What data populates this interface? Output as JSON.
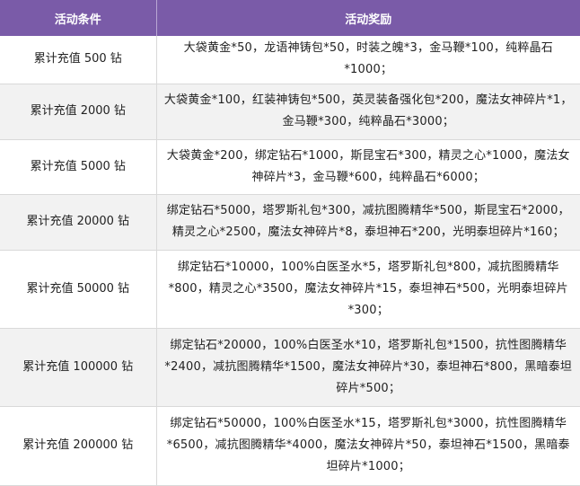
{
  "table": {
    "headers": [
      "活动条件",
      "活动奖励"
    ],
    "rows": [
      {
        "condition": "累计充值 500 钻",
        "reward": "大袋黄金*50，龙语神铸包*50，时装之魄*3，金马鞭*100，纯粹晶石*1000；"
      },
      {
        "condition": "累计充值 2000 钻",
        "reward": "大袋黄金*100，红装神铸包*500，英灵装备强化包*200，魔法女神碎片*1，金马鞭*300，纯粹晶石*3000；"
      },
      {
        "condition": "累计充值 5000 钻",
        "reward": "大袋黄金*200，绑定钻石*1000，斯昆宝石*300，精灵之心*1000，魔法女神碎片*3，金马鞭*600，纯粹晶石*6000；"
      },
      {
        "condition": "累计充值 20000 钻",
        "reward": "绑定钻石*5000，塔罗斯礼包*300，减抗图腾精华*500，斯昆宝石*2000，精灵之心*2500，魔法女神碎片*8，泰坦神石*200，光明泰坦碎片*160；"
      },
      {
        "condition": "累计充值 50000 钻",
        "reward": "绑定钻石*10000，100%白医圣水*5，塔罗斯礼包*800，减抗图腾精华*800，精灵之心*3500，魔法女神碎片*15，泰坦神石*500，光明泰坦碎片*300；"
      },
      {
        "condition": "累计充值 100000 钻",
        "reward": "绑定钻石*20000，100%白医圣水*10，塔罗斯礼包*1500，抗性图腾精华*2400，减抗图腾精华*1500，魔法女神碎片*30，泰坦神石*800，黑暗泰坦碎片*500；"
      },
      {
        "condition": "累计充值 200000 钻",
        "reward": "绑定钻石*50000，100%白医圣水*15，塔罗斯礼包*3000，抗性图腾精华*6500，减抗图腾精华*4000，魔法女神碎片*50，泰坦神石*1500，黑暗泰坦碎片*1000；"
      }
    ]
  }
}
